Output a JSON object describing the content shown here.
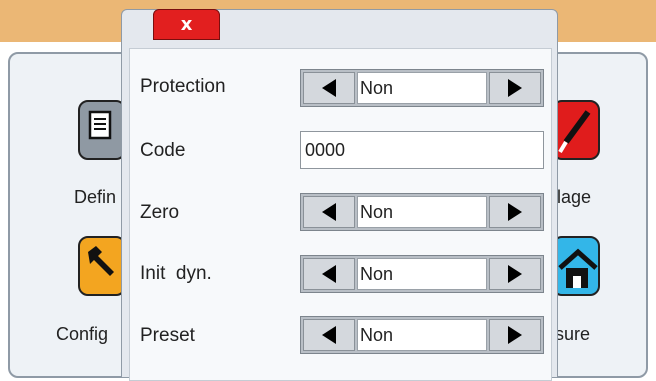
{
  "background_apps": [
    {
      "label": "Defin",
      "icon": "document-icon",
      "color": "#8f99a3"
    },
    {
      "label": "Config",
      "icon": "wrench-icon",
      "color": "#f3a520"
    },
    {
      "label": "llage",
      "icon": "screwdriver-icon",
      "color": "#e01c1c"
    },
    {
      "label": "sure",
      "icon": "house-icon",
      "color": "#33b6e8"
    }
  ],
  "dialog": {
    "close_label": "x",
    "rows": [
      {
        "label": "Protection",
        "type": "spinner",
        "value": "Non"
      },
      {
        "label": "Code",
        "type": "text",
        "value": "0000"
      },
      {
        "label": "Zero",
        "type": "spinner",
        "value": "Non"
      },
      {
        "label": "Init  dyn.",
        "type": "spinner",
        "value": "Non"
      },
      {
        "label": "Preset",
        "type": "spinner",
        "value": "Non"
      }
    ]
  },
  "colors": {
    "header_bar": "#ebb775",
    "close_button": "#e21f1f"
  }
}
